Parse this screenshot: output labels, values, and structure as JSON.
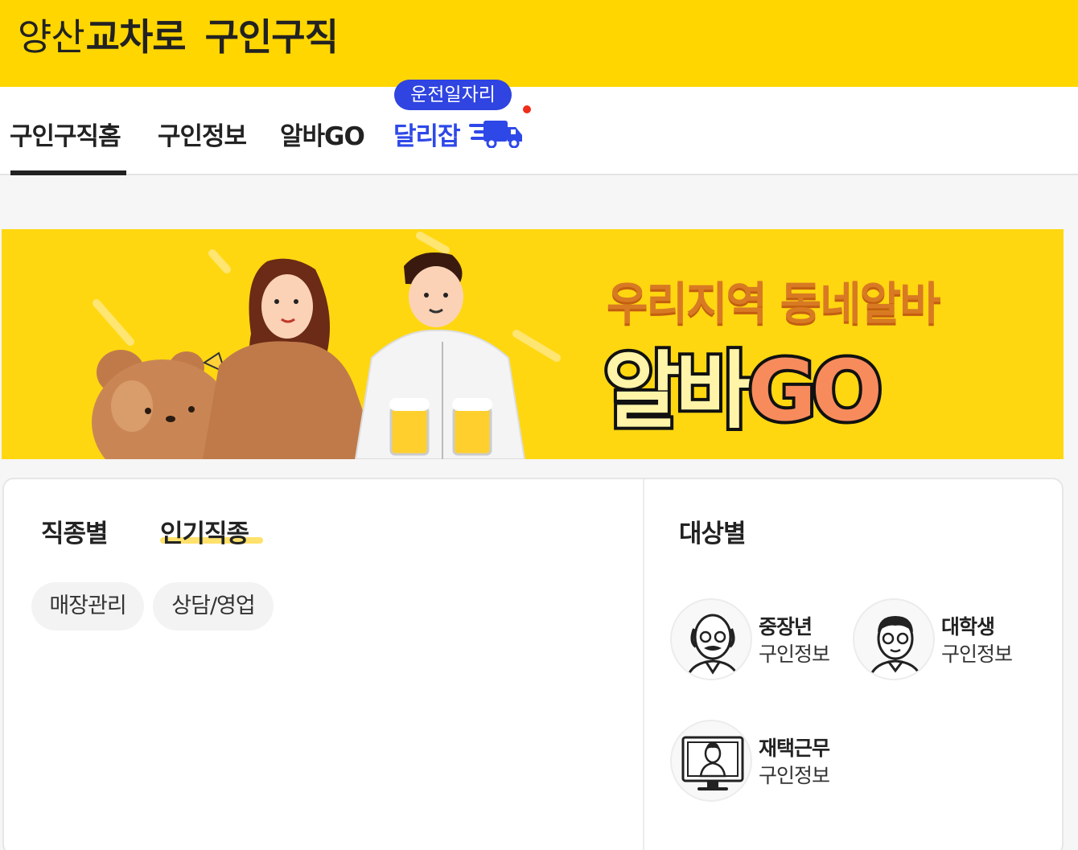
{
  "header": {
    "logo_part1": "양산",
    "logo_part2": "교차로",
    "logo_part3": "구인구직"
  },
  "nav": {
    "tabs": [
      {
        "label": "구인구직홈",
        "active": true
      },
      {
        "label": "구인정보"
      },
      {
        "label": "알바GO"
      },
      {
        "label": "달리잡",
        "badge": "운전일자리"
      }
    ]
  },
  "banner": {
    "subtitle": "우리지역 동네알바",
    "title_korean": "알바",
    "title_latin": "GO"
  },
  "jobs": {
    "tabs": [
      {
        "label": "직종별"
      },
      {
        "label": "인기직종",
        "active": true
      }
    ],
    "chips": [
      "매장관리",
      "상담/영업"
    ]
  },
  "targets": {
    "title": "대상별",
    "items": [
      {
        "name": "중장년",
        "sub": "구인정보",
        "icon": "senior-avatar-icon"
      },
      {
        "name": "대학생",
        "sub": "구인정보",
        "icon": "student-avatar-icon"
      },
      {
        "name": "재택근무",
        "sub": "구인정보",
        "icon": "remote-work-avatar-icon"
      }
    ]
  },
  "colors": {
    "brand_yellow": "#ffd600",
    "accent_blue": "#2f44e0",
    "notify_red": "#f02d1a",
    "go_orange": "#f88b5c"
  }
}
